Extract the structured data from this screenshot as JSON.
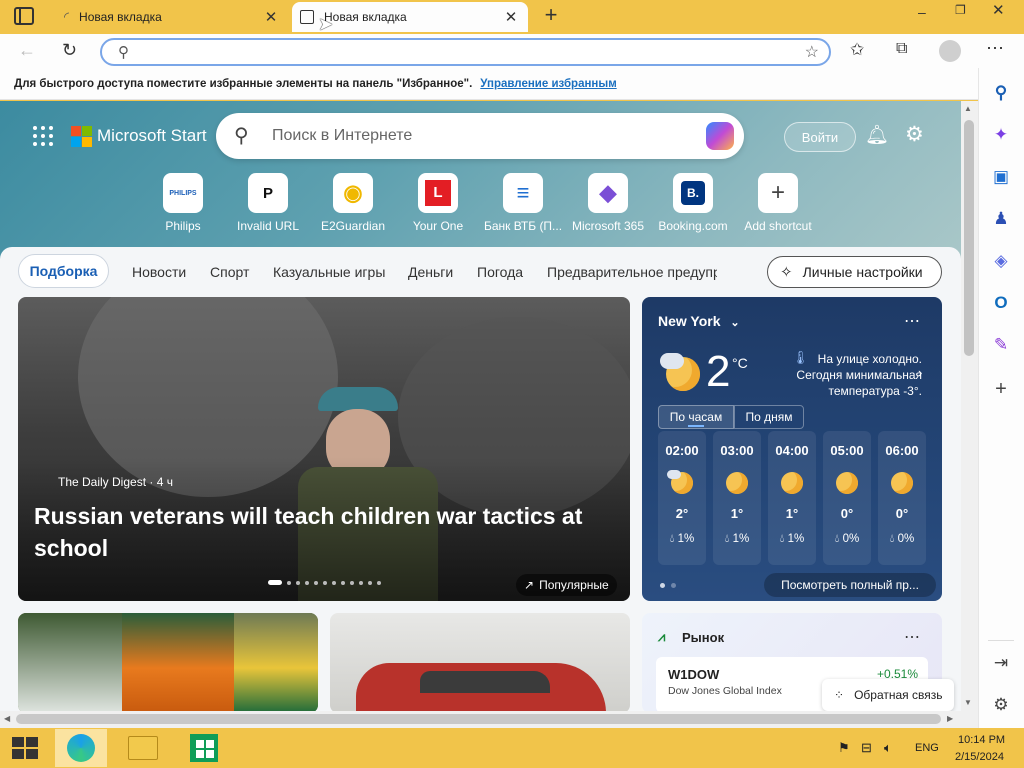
{
  "browser": {
    "tabs": [
      {
        "title": "Новая вкладка",
        "active": false
      },
      {
        "title": "Новая вкладка",
        "active": true
      }
    ],
    "address": {
      "value": "",
      "placeholder": ""
    },
    "favorites_bar": {
      "text": "Для быстрого доступа поместите избранные элементы на панель \"Избранное\".",
      "link": "Управление избранным"
    }
  },
  "start": {
    "logo": "Microsoft Start",
    "search_placeholder": "Поиск в Интернете",
    "signin": "Войти",
    "quicklinks": [
      {
        "label": "Philips",
        "icon_text": "PHILIPS",
        "color": "#1b5fb8"
      },
      {
        "label": "Invalid URL",
        "icon_text": "P",
        "color": "#111111"
      },
      {
        "label": "E2Guardian",
        "icon_text": "◉",
        "color": "#f0b800"
      },
      {
        "label": "Your One",
        "icon_text": "L",
        "color": "#e31e24"
      },
      {
        "label": "Банк ВТБ (П...",
        "icon_text": "≡",
        "color": "#1f6fd1"
      },
      {
        "label": "Microsoft 365",
        "icon_text": "◆",
        "color": "#7b4fd6"
      },
      {
        "label": "Booking.com",
        "icon_text": "B.",
        "color": "#003580"
      },
      {
        "label": "Add shortcut",
        "icon_text": "+",
        "color": "#444444"
      }
    ],
    "categories": [
      "Подборка",
      "Новости",
      "Спорт",
      "Казуальные игры",
      "Деньги",
      "Погода",
      "Предварительное предупр"
    ],
    "personal_settings": "Личные настройки",
    "news": {
      "source": "The Daily Digest",
      "age": "· 4 ч",
      "headline": "Russian veterans will teach children war tactics at school",
      "badge": "Популярные"
    },
    "weather": {
      "city": "New York",
      "temp": "2",
      "unit": "°C",
      "note": "На улице холодно. Сегодня минимальная температура -3°.",
      "tabs": [
        "По часам",
        "По дням"
      ],
      "hours": [
        {
          "time": "02:00",
          "temp": "2°",
          "precip": "1%",
          "icon": "cloudy-moon-icon"
        },
        {
          "time": "03:00",
          "temp": "1°",
          "precip": "1%",
          "icon": "moon-icon"
        },
        {
          "time": "04:00",
          "temp": "1°",
          "precip": "1%",
          "icon": "moon-icon"
        },
        {
          "time": "05:00",
          "temp": "0°",
          "precip": "0%",
          "icon": "moon-icon"
        },
        {
          "time": "06:00",
          "temp": "0°",
          "precip": "0%",
          "icon": "moon-icon"
        }
      ],
      "see_full": "Посмотреть полный пр..."
    },
    "market": {
      "title": "Рынок",
      "ticker": "W1DOW",
      "name": "Dow Jones Global Index",
      "change": "+0.51%"
    },
    "feedback": "Обратная связь"
  },
  "taskbar": {
    "lang": "ENG",
    "time": "10:14 PM",
    "date": "2/15/2024"
  },
  "colors": {
    "accent": "#1a5fb4",
    "titlebar": "#f1c44a",
    "weather_bg": "#1e3a66",
    "positive": "#1a8a3a"
  }
}
